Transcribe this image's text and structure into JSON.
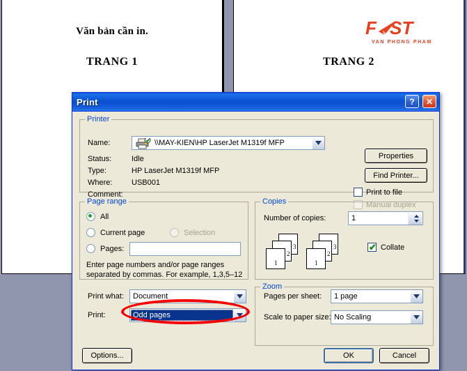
{
  "document": {
    "page1": {
      "line1": "Văn bản cần in.",
      "line2": "TRANG 1"
    },
    "page2": {
      "line1": "TRANG 2",
      "logo_text": "FAST",
      "logo_tagline": "VAN PHONG PHAM",
      "logo_color": "#e8401f"
    }
  },
  "dialog": {
    "title": "Print",
    "help_button": "?",
    "close_button": "✕",
    "printer": {
      "group_label": "Printer",
      "name_label": "Name:",
      "name_value": "\\\\MAY-KIEN\\HP LaserJet M1319f MFP",
      "status_label": "Status:",
      "status_value": "Idle",
      "type_label": "Type:",
      "type_value": "HP LaserJet M1319f MFP",
      "where_label": "Where:",
      "where_value": "USB001",
      "comment_label": "Comment:",
      "comment_value": "",
      "properties_button": "Properties",
      "find_printer_button": "Find Printer...",
      "print_to_file_label": "Print to file",
      "print_to_file_checked": false,
      "manual_duplex_label": "Manual duplex",
      "manual_duplex_checked": false,
      "manual_duplex_disabled": true
    },
    "page_range": {
      "group_label": "Page range",
      "all_label": "All",
      "all_selected": true,
      "current_page_label": "Current page",
      "selection_label": "Selection",
      "selection_disabled": true,
      "pages_label": "Pages:",
      "pages_value": "",
      "hint_line1": "Enter page numbers and/or page ranges",
      "hint_line2": "separated by commas.  For example, 1,3,5–12"
    },
    "copies": {
      "group_label": "Copies",
      "number_label": "Number of copies:",
      "number_value": "1",
      "collate_label": "Collate",
      "collate_checked": true,
      "sheet_numbers": [
        "1",
        "2",
        "3"
      ]
    },
    "print_what": {
      "label": "Print what:",
      "value": "Document"
    },
    "print_selector": {
      "label": "Print:",
      "value": "Odd pages",
      "highlighted": true
    },
    "zoom": {
      "group_label": "Zoom",
      "pages_per_sheet_label": "Pages per sheet:",
      "pages_per_sheet_value": "1 page",
      "scale_label": "Scale to paper size:",
      "scale_value": "No Scaling"
    },
    "footer": {
      "options_button": "Options...",
      "ok_button": "OK",
      "cancel_button": "Cancel"
    }
  },
  "annotation": {
    "shape": "red-oval",
    "color": "#f40000",
    "targets": "print-selector-combo"
  }
}
